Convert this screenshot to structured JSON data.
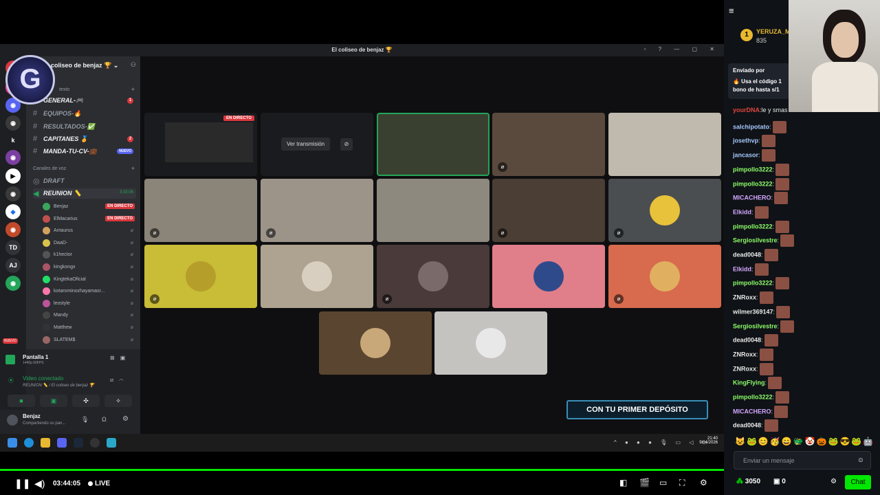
{
  "discord": {
    "window_title": "El coliseo de benjaz 🏆",
    "server_name": "coliseo de benjaz 🏆",
    "categories": {
      "text": "texto",
      "voice": "Canales de voz"
    },
    "text_channels": [
      {
        "label": "GENERAL-🎮",
        "badge": "1"
      },
      {
        "label": "EQUIPOS-🔥",
        "badge": ""
      },
      {
        "label": "RESULTADOS-✅",
        "badge": ""
      },
      {
        "label": "CAPITANES 🏅",
        "badge": "2"
      },
      {
        "label": "MANDA-TU-CV-💼",
        "badge": "NUEVO"
      }
    ],
    "voice_channels": [
      {
        "label": "DRAFT"
      },
      {
        "label": "REUNION 📏",
        "timer": "3:33:06"
      }
    ],
    "voice_users": [
      {
        "name": "Benjaz",
        "live": "EN DIRECTO",
        "color": "#3ba55c"
      },
      {
        "name": "ElMacarius",
        "live": "EN DIRECTO",
        "color": "#c0504d"
      },
      {
        "name": "Antaurus",
        "live": "",
        "color": "#d4a25f"
      },
      {
        "name": "DaaD-",
        "live": "",
        "color": "#d8c24a"
      },
      {
        "name": "k1hector",
        "live": "",
        "color": "#555"
      },
      {
        "name": "kingkongx",
        "live": "",
        "color": "#a56"
      },
      {
        "name": "KingtekaOficial",
        "live": "",
        "color": "#2d6"
      },
      {
        "name": "kotarominozhayamasr...",
        "live": "",
        "color": "#f7a"
      },
      {
        "name": "leostyle",
        "live": "",
        "color": "#b59"
      },
      {
        "name": "Mandy",
        "live": "",
        "color": "#444"
      },
      {
        "name": "Matthew",
        "live": "",
        "color": "#333"
      },
      {
        "name": "SLATEM$",
        "live": "",
        "color": "#966"
      }
    ],
    "screen_share": {
      "title": "Pantalla 1",
      "subtitle": "1440p 60FPS"
    },
    "voice_status": {
      "title": "Video conectado",
      "channel": "REUNION 📏 / El coliseo de benjaz 🏆"
    },
    "user": {
      "name": "Benjaz",
      "status": "Compartiendo su pan..."
    },
    "servers": [
      "TD",
      "AJ"
    ],
    "server_badge": "NUEVO"
  },
  "grid": {
    "live_badge": "EN DIRECTO",
    "watch_button": "Ver transmisión"
  },
  "overlay_banner": "CON TU PRIMER DEPÓSITO",
  "taskbar": {
    "time": "21:40",
    "date": "9/04/2026"
  },
  "player": {
    "elapsed": "03:44:05",
    "live_label": "LIVE"
  },
  "chat": {
    "leaderboard": {
      "rank": "1",
      "name": "YERUZA_M",
      "points": "835"
    },
    "pinned": {
      "label": "Enviado por",
      "text": "🔥 Usa el código 1",
      "text2": "bono de hasta s/1"
    },
    "messages": [
      {
        "user": "yourDNA",
        "color": "#e0453c",
        "text": "le y smas"
      },
      {
        "user": "salchipotato",
        "color": "#a5c8ff",
        "text": ""
      },
      {
        "user": "josethvp",
        "color": "#a5c8ff",
        "text": ""
      },
      {
        "user": "jancasor",
        "color": "#a5c8ff",
        "text": ""
      },
      {
        "user": "pimpollo3222",
        "color": "#8dff6a",
        "text": ""
      },
      {
        "user": "pimpollo3222",
        "color": "#8dff6a",
        "text": ""
      },
      {
        "user": "MICACHERO",
        "color": "#d3a6ff",
        "text": ""
      },
      {
        "user": "Elkidd",
        "color": "#d3a6ff",
        "text": ""
      },
      {
        "user": "pimpollo3222",
        "color": "#8dff6a",
        "text": ""
      },
      {
        "user": "Sergiosilvestre",
        "color": "#8dff6a",
        "text": ""
      },
      {
        "user": "dead0048",
        "color": "#e8e8e8",
        "text": ""
      },
      {
        "user": "Elkidd",
        "color": "#d3a6ff",
        "text": ""
      },
      {
        "user": "pimpollo3222",
        "color": "#8dff6a",
        "text": ""
      },
      {
        "user": "ZNRoxx",
        "color": "#e8e8e8",
        "text": ""
      },
      {
        "user": "wilmer369147",
        "color": "#e8e8e8",
        "text": ""
      },
      {
        "user": "Sergiosilvestre",
        "color": "#8dff6a",
        "text": ""
      },
      {
        "user": "dead0048",
        "color": "#e8e8e8",
        "text": ""
      },
      {
        "user": "ZNRoxx",
        "color": "#e8e8e8",
        "text": ""
      },
      {
        "user": "ZNRoxx",
        "color": "#e8e8e8",
        "text": ""
      },
      {
        "user": "KingFlying",
        "color": "#8dff6a",
        "text": ""
      },
      {
        "user": "pimpollo3222",
        "color": "#8dff6a",
        "text": ""
      },
      {
        "user": "MICACHERO",
        "color": "#d3a6ff",
        "text": ""
      },
      {
        "user": "dead0048",
        "color": "#e8e8e8",
        "text": ""
      }
    ],
    "input_placeholder": "Enviar un mensaje",
    "balance_points": "3050",
    "balance_other": "0",
    "chat_button": "Chat"
  },
  "colors": {
    "accent": "#00e701",
    "discord_bg": "#2b2d31",
    "chat_bg": "#0f1216"
  }
}
